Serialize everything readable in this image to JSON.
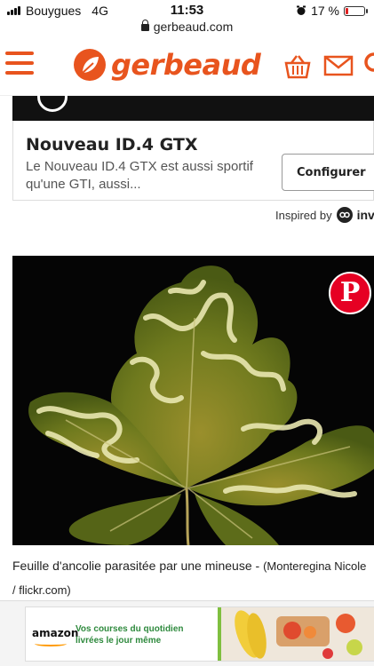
{
  "status_bar": {
    "carrier": "Bouygues",
    "network": "4G",
    "time": "11:53",
    "battery": "17 %",
    "battery_level": 0.17,
    "url": "gerbeaud.com"
  },
  "header": {
    "logo_text": "gerbeaud",
    "brand_color": "#e8541e",
    "icons": [
      "menu-icon",
      "basket-icon",
      "mail-icon",
      "search-icon"
    ]
  },
  "ad": {
    "title": "Nouveau ID.4 GTX",
    "description": "Le Nouveau ID.4 GTX est aussi sportif qu'une GTI, aussi...",
    "button_label": "Configurer",
    "inspired_label": "Inspired by",
    "inspired_brand": "invibe"
  },
  "article": {
    "caption_main": "Feuille d'ancolie parasitée par une mineuse - ",
    "caption_credit": "(Monteregina Nicole / flickr.com)",
    "pinterest_color": "#e60023"
  },
  "bottom_ad": {
    "brand": "amazon",
    "line1": "Vos courses du quotidien",
    "line2": "livrées le jour même"
  }
}
